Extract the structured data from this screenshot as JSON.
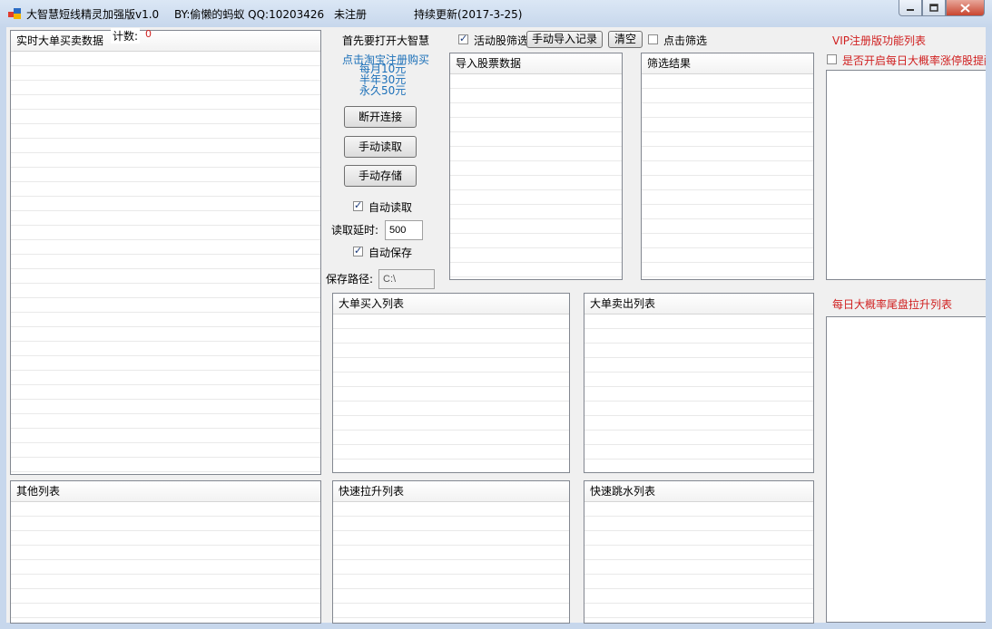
{
  "window": {
    "title": "大智慧短线精灵加强版v1.0",
    "author": "BY:偷懒的蚂蚁 QQ:10203426",
    "status": "未注册",
    "update": "持续更新(2017-3-25)"
  },
  "left": {
    "realtime_header": "实时大单买卖数据",
    "count_label": "计数:",
    "count_value": "0",
    "other_header": "其他列表"
  },
  "controls": {
    "notice": "首先要打开大智慧",
    "promo_title": "点击淘宝注册购买",
    "promo_lines": [
      "每月10元",
      "半年30元",
      "永久50元"
    ],
    "disconnect_button": "断开连接",
    "manual_read_button": "手动读取",
    "manual_save_button": "手动存储",
    "auto_read_label": "自动读取",
    "auto_read_checked": true,
    "read_delay_label": "读取延时:",
    "read_delay_value": "500",
    "auto_save_label": "自动保存",
    "auto_save_checked": true,
    "save_path_label": "保存路径:",
    "save_path_value": "C:\\"
  },
  "filter": {
    "active_filter_label": "活动股筛选",
    "active_filter_checked": true,
    "import_button": "手动导入记录",
    "clear_button": "清空",
    "click_filter_label": "点击筛选",
    "click_filter_checked": false,
    "import_header": "导入股票数据",
    "result_header": "筛选结果"
  },
  "lists": {
    "big_buy": "大单买入列表",
    "big_sell": "大单卖出列表",
    "fast_rise": "快速拉升列表",
    "fast_drop": "快速跳水列表"
  },
  "vip": {
    "title": "VIP注册版功能列表",
    "daily_limit_label": "是否开启每日大概率涨停股提醒",
    "daily_limit_checked": false,
    "tail_title": "每日大概率尾盘拉升列表"
  },
  "colors": {
    "accent_blue": "#1a6fb8",
    "accent_red": "#d02020"
  }
}
